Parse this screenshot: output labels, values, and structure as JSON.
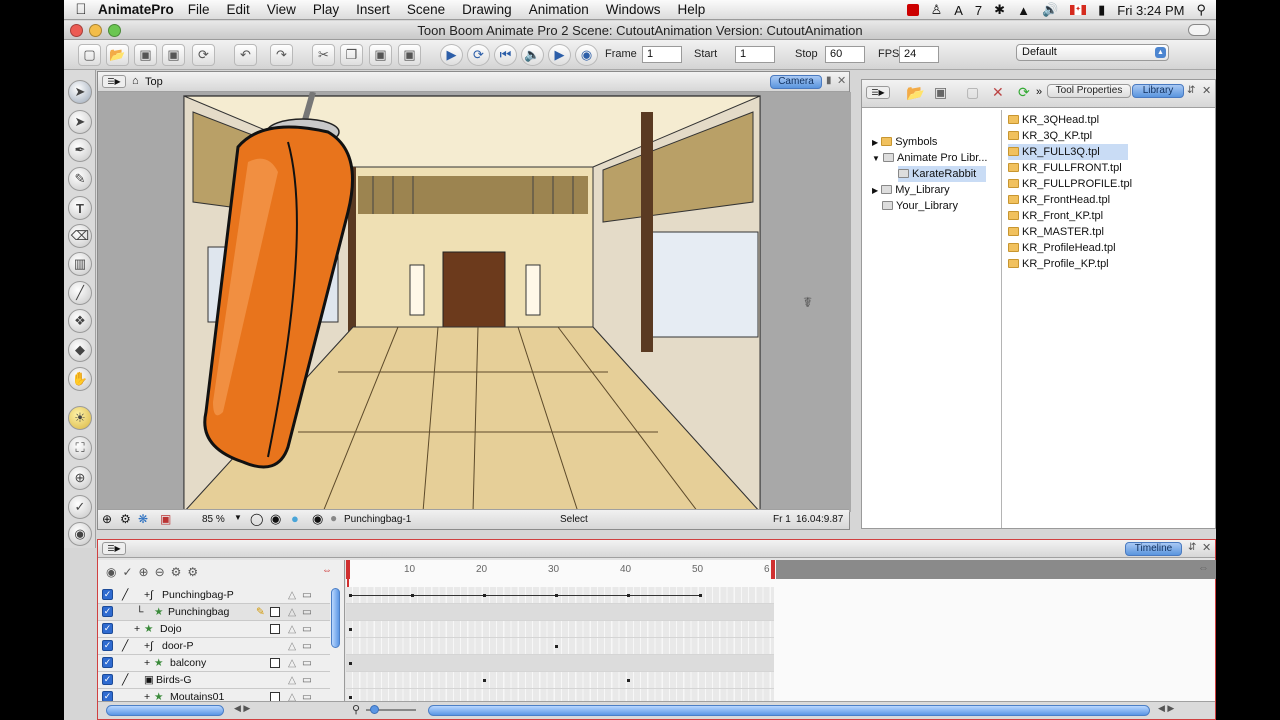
{
  "menubar": {
    "app_name": "AnimatePro",
    "items": [
      "File",
      "Edit",
      "View",
      "Play",
      "Insert",
      "Scene",
      "Drawing",
      "Animation",
      "Windows",
      "Help"
    ],
    "status": {
      "a7": "7",
      "clock": "Fri 3:24 PM"
    }
  },
  "window": {
    "title": "Toon Boom Animate Pro 2 Scene: CutoutAnimation Version: CutoutAnimation"
  },
  "toolbar": {
    "frame_label": "Frame",
    "frame_value": "1",
    "start_label": "Start",
    "start_value": "1",
    "stop_label": "Stop",
    "stop_value": "60",
    "fps_label": "FPS",
    "fps_value": "24",
    "workspace": "Default"
  },
  "view": {
    "breadcrumb": "Top",
    "camera_tab": "Camera",
    "zoom": "85 %",
    "layer_name": "Punchingbag-1",
    "tool_status": "Select",
    "frame_status": "Fr 1",
    "coords": "16.04:9.87"
  },
  "library": {
    "tabs": [
      "Tool Properties",
      "Library"
    ],
    "tree": [
      "Symbols",
      "Animate Pro Libr...",
      "KarateRabbit",
      "My_Library",
      "Your_Library"
    ],
    "files": [
      "KR_3QHead.tpl",
      "KR_3Q_KP.tpl",
      "KR_FULL3Q.tpl",
      "KR_FULLFRONT.tpl",
      "KR_FULLPROFILE.tpl",
      "KR_FrontHead.tpl",
      "KR_Front_KP.tpl",
      "KR_MASTER.tpl",
      "KR_ProfileHead.tpl",
      "KR_Profile_KP.tpl"
    ],
    "selected_file": "KR_FULL3Q.tpl"
  },
  "timeline": {
    "tab": "Timeline",
    "ruler": [
      "10",
      "20",
      "30",
      "40",
      "50",
      "6"
    ],
    "layers": [
      "Punchingbag-P",
      "Punchingbag",
      "Dojo",
      "door-P",
      "balcony",
      "Birds-G",
      "Moutains01"
    ]
  },
  "colors": {
    "accent": "#5a95de",
    "selection": "#c9dcf5",
    "bag": "#e8741c"
  }
}
